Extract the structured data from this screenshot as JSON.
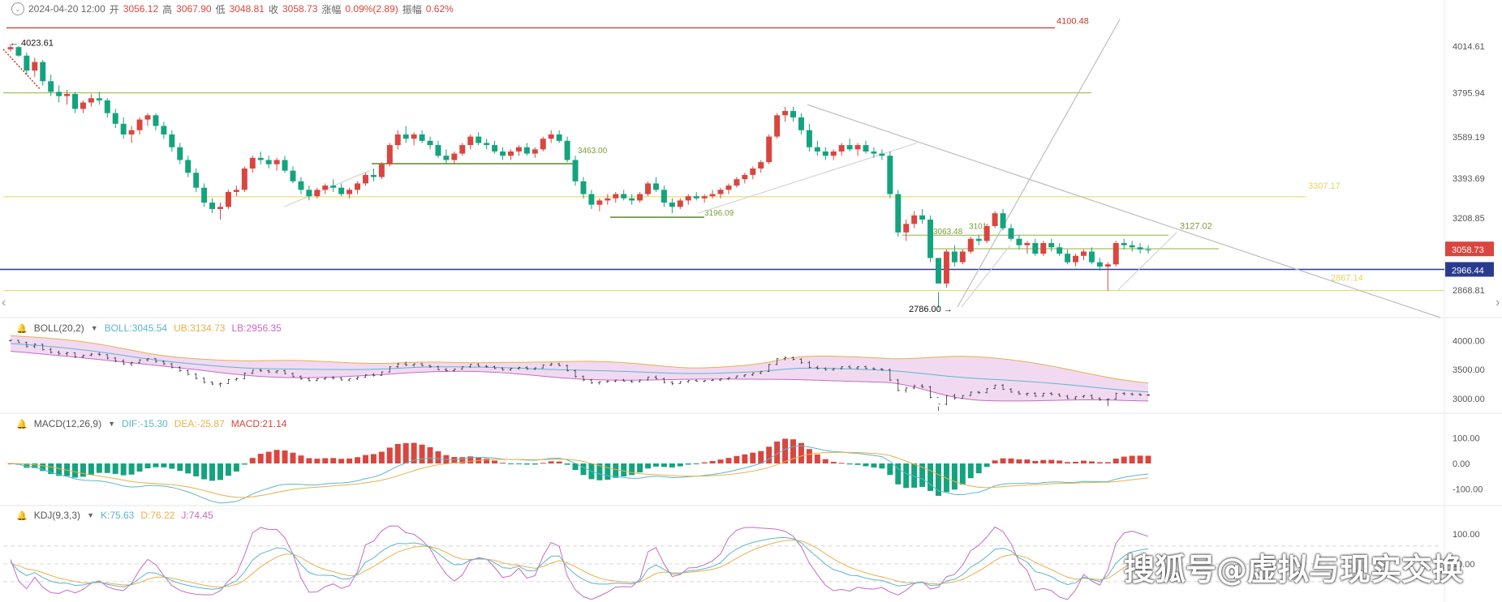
{
  "header": {
    "timestamp": "2024-04-20 12:00",
    "open_label": "开",
    "open": "3056.12",
    "high_label": "高",
    "high": "3067.90",
    "low_label": "低",
    "low": "3048.81",
    "close_label": "收",
    "close": "3058.73",
    "change_label": "涨幅",
    "change": "0.09%(2.89)",
    "amp_label": "振幅",
    "amp": "0.62%"
  },
  "price_axis_labels": [
    "4014.61",
    "3795.94",
    "3589.19",
    "3393.69",
    "3208.85",
    "3058.73",
    "2966.44",
    "2868.81"
  ],
  "current_price_tag": "3058.73",
  "line_price_tag": "2966.44",
  "annotations": [
    "4100.48",
    "4023.61",
    "3307.17",
    "3127.02",
    "2867.14",
    "2786.00",
    "3196.09",
    "3101",
    "3063.48",
    "3463.00"
  ],
  "boll": {
    "name": "BOLL(20,2)",
    "mid": "BOLL:3045.54",
    "ub": "UB:3134.73",
    "lb": "LB:2956.35",
    "axis": [
      "4000.00",
      "3500.00",
      "3000.00"
    ]
  },
  "macd": {
    "name": "MACD(12,26,9)",
    "dif": "DIF:-15.30",
    "dea": "DEA:-25.87",
    "macd": "MACD:21.14",
    "axis": [
      "100.00",
      "0.00",
      "-100.00"
    ]
  },
  "kdj": {
    "name": "KDJ(9,3,3)",
    "k": "K:75.63",
    "d": "D:76.22",
    "j": "J:74.45",
    "axis": [
      "100.00",
      "50.00"
    ]
  },
  "watermark": "搜狐号@虚拟与现实交换",
  "colors": {
    "up": "#d9463f",
    "down": "#14a37f",
    "ma": "#5bb7c9",
    "ub": "#e8b04a",
    "lb": "#c66bc3",
    "boll_fill": "#f2d9f2",
    "res_green": "#8fb33c",
    "res_yellow": "#e5d55a",
    "red_line": "#c0392b",
    "navy": "#2a3b8f"
  },
  "chart_data": {
    "type": "candlestick",
    "title": "",
    "ylim": [
      2740,
      4140
    ],
    "candles": [
      [
        4000,
        4023.61,
        3990,
        4010
      ],
      [
        4010,
        4015,
        3965,
        3970
      ],
      [
        3970,
        3985,
        3880,
        3900
      ],
      [
        3900,
        3960,
        3870,
        3940
      ],
      [
        3940,
        3950,
        3830,
        3850
      ],
      [
        3850,
        3880,
        3780,
        3800
      ],
      [
        3800,
        3830,
        3750,
        3780
      ],
      [
        3780,
        3810,
        3740,
        3790
      ],
      [
        3790,
        3800,
        3700,
        3720
      ],
      [
        3720,
        3760,
        3700,
        3750
      ],
      [
        3750,
        3790,
        3730,
        3770
      ],
      [
        3770,
        3800,
        3740,
        3760
      ],
      [
        3760,
        3770,
        3680,
        3700
      ],
      [
        3700,
        3720,
        3630,
        3650
      ],
      [
        3650,
        3680,
        3580,
        3600
      ],
      [
        3600,
        3640,
        3560,
        3620
      ],
      [
        3620,
        3680,
        3600,
        3670
      ],
      [
        3670,
        3700,
        3640,
        3690
      ],
      [
        3690,
        3700,
        3620,
        3640
      ],
      [
        3640,
        3660,
        3580,
        3600
      ],
      [
        3600,
        3620,
        3520,
        3540
      ],
      [
        3540,
        3560,
        3460,
        3480
      ],
      [
        3480,
        3500,
        3400,
        3420
      ],
      [
        3420,
        3440,
        3330,
        3350
      ],
      [
        3350,
        3370,
        3260,
        3280
      ],
      [
        3280,
        3300,
        3230,
        3250
      ],
      [
        3250,
        3280,
        3200,
        3260
      ],
      [
        3260,
        3340,
        3250,
        3330
      ],
      [
        3330,
        3360,
        3310,
        3340
      ],
      [
        3340,
        3450,
        3330,
        3440
      ],
      [
        3440,
        3500,
        3420,
        3490
      ],
      [
        3490,
        3520,
        3460,
        3480
      ],
      [
        3480,
        3500,
        3440,
        3460
      ],
      [
        3460,
        3490,
        3430,
        3480
      ],
      [
        3480,
        3500,
        3420,
        3430
      ],
      [
        3430,
        3450,
        3370,
        3380
      ],
      [
        3380,
        3400,
        3320,
        3340
      ],
      [
        3340,
        3360,
        3290,
        3310
      ],
      [
        3310,
        3350,
        3300,
        3340
      ],
      [
        3340,
        3370,
        3320,
        3360
      ],
      [
        3360,
        3390,
        3330,
        3350
      ],
      [
        3350,
        3370,
        3310,
        3320
      ],
      [
        3320,
        3350,
        3300,
        3340
      ],
      [
        3340,
        3380,
        3320,
        3370
      ],
      [
        3370,
        3420,
        3360,
        3410
      ],
      [
        3410,
        3440,
        3380,
        3400
      ],
      [
        3400,
        3470,
        3390,
        3460
      ],
      [
        3460,
        3560,
        3450,
        3550
      ],
      [
        3550,
        3620,
        3530,
        3600
      ],
      [
        3600,
        3640,
        3560,
        3580
      ],
      [
        3580,
        3610,
        3550,
        3600
      ],
      [
        3600,
        3620,
        3560,
        3570
      ],
      [
        3570,
        3590,
        3530,
        3550
      ],
      [
        3550,
        3570,
        3490,
        3500
      ],
      [
        3500,
        3530,
        3460,
        3480
      ],
      [
        3480,
        3520,
        3460,
        3510
      ],
      [
        3510,
        3560,
        3500,
        3550
      ],
      [
        3550,
        3600,
        3530,
        3590
      ],
      [
        3590,
        3610,
        3550,
        3560
      ],
      [
        3560,
        3580,
        3530,
        3550
      ],
      [
        3550,
        3570,
        3510,
        3520
      ],
      [
        3520,
        3540,
        3480,
        3500
      ],
      [
        3500,
        3530,
        3480,
        3520
      ],
      [
        3520,
        3550,
        3500,
        3540
      ],
      [
        3540,
        3560,
        3500,
        3510
      ],
      [
        3510,
        3540,
        3490,
        3530
      ],
      [
        3530,
        3590,
        3520,
        3580
      ],
      [
        3580,
        3620,
        3560,
        3600
      ],
      [
        3600,
        3620,
        3560,
        3570
      ],
      [
        3570,
        3590,
        3470,
        3480
      ],
      [
        3480,
        3500,
        3360,
        3380
      ],
      [
        3380,
        3400,
        3300,
        3320
      ],
      [
        3320,
        3340,
        3250,
        3270
      ],
      [
        3270,
        3300,
        3240,
        3290
      ],
      [
        3290,
        3320,
        3270,
        3300
      ],
      [
        3300,
        3330,
        3280,
        3320
      ],
      [
        3320,
        3340,
        3290,
        3300
      ],
      [
        3300,
        3320,
        3270,
        3290
      ],
      [
        3290,
        3330,
        3280,
        3320
      ],
      [
        3320,
        3380,
        3310,
        3370
      ],
      [
        3370,
        3400,
        3330,
        3340
      ],
      [
        3340,
        3360,
        3260,
        3280
      ],
      [
        3280,
        3300,
        3230,
        3260
      ],
      [
        3260,
        3300,
        3250,
        3290
      ],
      [
        3290,
        3320,
        3270,
        3310
      ],
      [
        3310,
        3330,
        3290,
        3300
      ],
      [
        3300,
        3320,
        3280,
        3310
      ],
      [
        3310,
        3340,
        3300,
        3320
      ],
      [
        3320,
        3350,
        3300,
        3340
      ],
      [
        3340,
        3370,
        3320,
        3360
      ],
      [
        3360,
        3400,
        3350,
        3390
      ],
      [
        3390,
        3420,
        3370,
        3410
      ],
      [
        3410,
        3450,
        3390,
        3440
      ],
      [
        3440,
        3480,
        3420,
        3470
      ],
      [
        3470,
        3600,
        3460,
        3590
      ],
      [
        3590,
        3700,
        3580,
        3690
      ],
      [
        3690,
        3730,
        3660,
        3710
      ],
      [
        3710,
        3730,
        3660,
        3680
      ],
      [
        3680,
        3700,
        3600,
        3620
      ],
      [
        3620,
        3650,
        3520,
        3540
      ],
      [
        3540,
        3570,
        3500,
        3520
      ],
      [
        3520,
        3540,
        3480,
        3500
      ],
      [
        3500,
        3530,
        3480,
        3520
      ],
      [
        3520,
        3560,
        3500,
        3550
      ],
      [
        3550,
        3580,
        3520,
        3530
      ],
      [
        3530,
        3560,
        3500,
        3550
      ],
      [
        3550,
        3570,
        3510,
        3520
      ],
      [
        3520,
        3540,
        3490,
        3510
      ],
      [
        3510,
        3530,
        3480,
        3500
      ],
      [
        3500,
        3520,
        3300,
        3320
      ],
      [
        3320,
        3340,
        3120,
        3140
      ],
      [
        3140,
        3200,
        3100,
        3180
      ],
      [
        3180,
        3240,
        3160,
        3220
      ],
      [
        3220,
        3250,
        3180,
        3200
      ],
      [
        3200,
        3220,
        3000,
        3020
      ],
      [
        3020,
        2860,
        2786.0,
        2900
      ],
      [
        2900,
        3060,
        2880,
        3050
      ],
      [
        3050,
        3080,
        2980,
        3000
      ],
      [
        3000,
        3060,
        2990,
        3050
      ],
      [
        3050,
        3120,
        3040,
        3110
      ],
      [
        3110,
        3130,
        3080,
        3100
      ],
      [
        3100,
        3180,
        3090,
        3170
      ],
      [
        3170,
        3240,
        3160,
        3230
      ],
      [
        3230,
        3250,
        3150,
        3160
      ],
      [
        3160,
        3180,
        3100,
        3110
      ],
      [
        3110,
        3130,
        3060,
        3080
      ],
      [
        3080,
        3100,
        3040,
        3090
      ],
      [
        3090,
        3110,
        3030,
        3040
      ],
      [
        3040,
        3100,
        3030,
        3090
      ],
      [
        3090,
        3110,
        3050,
        3070
      ],
      [
        3070,
        3090,
        3030,
        3040
      ],
      [
        3040,
        3060,
        2990,
        3000
      ],
      [
        3000,
        3040,
        2980,
        3030
      ],
      [
        3030,
        3060,
        3010,
        3050
      ],
      [
        3050,
        3070,
        2990,
        3000
      ],
      [
        3000,
        3020,
        2960,
        2980
      ],
      [
        2980,
        3000,
        2867.14,
        2990
      ],
      [
        2990,
        3100,
        2980,
        3090
      ],
      [
        3090,
        3110,
        3060,
        3080
      ],
      [
        3080,
        3100,
        3050,
        3070
      ],
      [
        3070,
        3090,
        3040,
        3060
      ],
      [
        3060,
        3080,
        3040,
        3058.73
      ]
    ],
    "boll_series": {
      "ub": [
        4090,
        4082,
        4073,
        4064,
        4054,
        4043,
        4031,
        4017,
        4001,
        3983,
        3963,
        3941,
        3917,
        3891,
        3864,
        3837,
        3810,
        3785,
        3762,
        3742,
        3725,
        3711,
        3700,
        3690,
        3681,
        3672,
        3665,
        3660,
        3657,
        3655,
        3655,
        3656,
        3658,
        3660,
        3661,
        3661,
        3658,
        3654,
        3648,
        3641,
        3634,
        3627,
        3620,
        3614,
        3610,
        3608,
        3608,
        3611,
        3616,
        3622,
        3627,
        3631,
        3632,
        3631,
        3628,
        3624,
        3621,
        3620,
        3621,
        3623,
        3624,
        3625,
        3626,
        3627,
        3628,
        3629,
        3631,
        3634,
        3637,
        3640,
        3644,
        3646,
        3645,
        3641,
        3636,
        3629,
        3621,
        3611,
        3600,
        3587,
        3574,
        3560,
        3547,
        3537,
        3531,
        3529,
        3531,
        3536,
        3544,
        3553,
        3563,
        3575,
        3590,
        3608,
        3632,
        3659,
        3686,
        3708,
        3722,
        3731,
        3735,
        3736,
        3734,
        3730,
        3725,
        3719,
        3713,
        3706,
        3700,
        3692,
        3690,
        3691,
        3696,
        3704,
        3712,
        3720,
        3727,
        3731,
        3731,
        3728,
        3721,
        3712,
        3700,
        3686,
        3670,
        3652,
        3633,
        3611,
        3588,
        3562,
        3535,
        3507,
        3478,
        3449,
        3420,
        3392,
        3366,
        3342,
        3320,
        3301,
        3284,
        3270
      ],
      "lb": [
        3820,
        3808,
        3796,
        3783,
        3770,
        3757,
        3744,
        3731,
        3717,
        3703,
        3689,
        3675,
        3661,
        3646,
        3631,
        3617,
        3603,
        3589,
        3575,
        3560,
        3545,
        3530,
        3515,
        3499,
        3482,
        3466,
        3449,
        3433,
        3418,
        3404,
        3392,
        3382,
        3374,
        3368,
        3363,
        3360,
        3359,
        3360,
        3363,
        3367,
        3372,
        3377,
        3383,
        3390,
        3398,
        3406,
        3414,
        3423,
        3432,
        3441,
        3449,
        3456,
        3462,
        3467,
        3470,
        3472,
        3472,
        3470,
        3466,
        3461,
        3454,
        3446,
        3436,
        3424,
        3412,
        3399,
        3386,
        3373,
        3361,
        3350,
        3341,
        3333,
        3327,
        3323,
        3320,
        3318,
        3317,
        3317,
        3318,
        3320,
        3322,
        3325,
        3328,
        3331,
        3333,
        3335,
        3336,
        3337,
        3337,
        3337,
        3336,
        3335,
        3334,
        3333,
        3332,
        3331,
        3330,
        3328,
        3325,
        3321,
        3317,
        3312,
        3307,
        3302,
        3298,
        3294,
        3290,
        3286,
        3281,
        3272,
        3255,
        3230,
        3198,
        3162,
        3124,
        3086,
        3052,
        3022,
        2999,
        2981,
        2969,
        2962,
        2958,
        2957,
        2956.35,
        2957,
        2958,
        2960,
        2963,
        2966,
        2969,
        2972,
        2974,
        2976,
        2976,
        2975,
        2973,
        2970,
        2966,
        2962,
        2958,
        2956.35
      ],
      "mid_last": 3045.54
    },
    "macd_last": {
      "dif": -15.3,
      "dea": -25.87,
      "macd": 21.14
    },
    "kdj_last": {
      "k": 75.63,
      "d": 76.22,
      "j": 74.45
    }
  }
}
